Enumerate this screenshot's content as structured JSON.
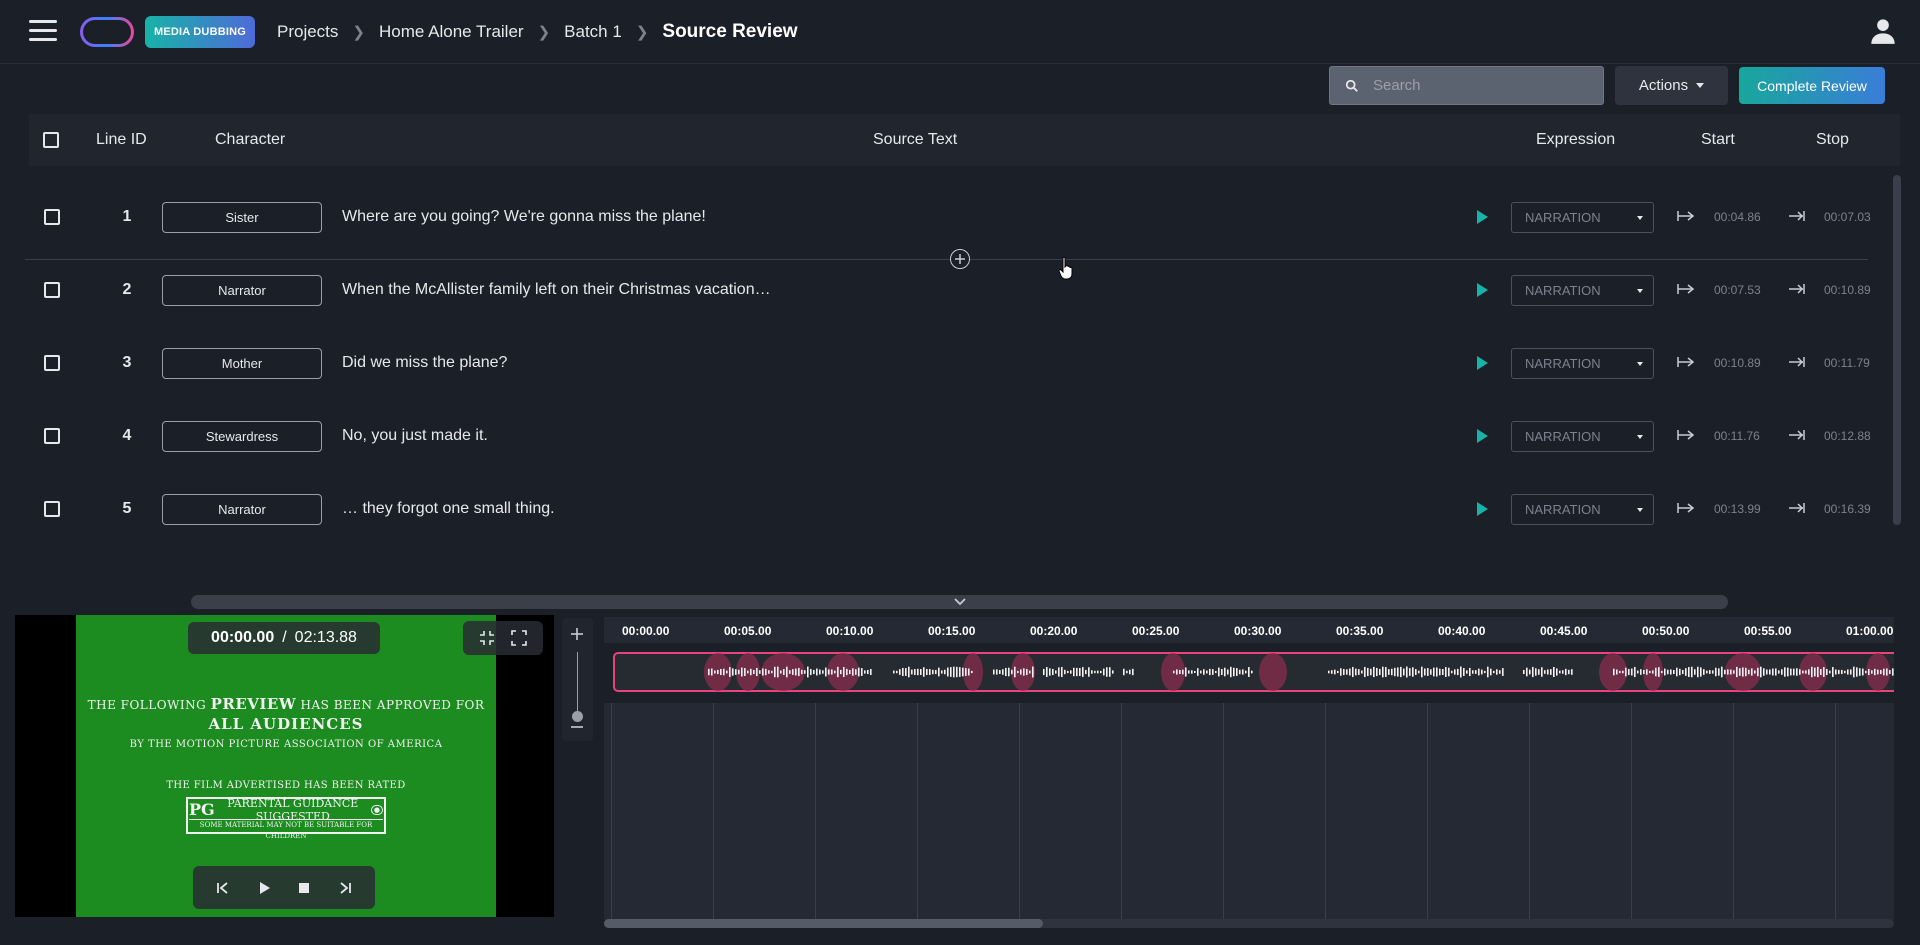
{
  "app": {
    "badge": "MEDIA DUBBING"
  },
  "breadcrumb": [
    "Projects",
    "Home Alone Trailer",
    "Batch 1",
    "Source Review"
  ],
  "toolbar": {
    "search_placeholder": "Search",
    "actions_label": "Actions",
    "complete_label": "Complete Review"
  },
  "table": {
    "headers": {
      "line_id": "Line ID",
      "character": "Character",
      "source_text": "Source Text",
      "expression": "Expression",
      "start": "Start",
      "stop": "Stop"
    },
    "rows": [
      {
        "id": "1",
        "character": "Sister",
        "text": "Where are you going? We're gonna miss the plane!",
        "expression": "NARRATION",
        "start": "00:04.86",
        "stop": "00:07.03"
      },
      {
        "id": "2",
        "character": "Narrator",
        "text": "When the McAllister family left on their Christmas vacation…",
        "expression": "NARRATION",
        "start": "00:07.53",
        "stop": "00:10.89"
      },
      {
        "id": "3",
        "character": "Mother",
        "text": "Did we miss the plane?",
        "expression": "NARRATION",
        "start": "00:10.89",
        "stop": "00:11.79"
      },
      {
        "id": "4",
        "character": "Stewardress",
        "text": "No, you just made it.",
        "expression": "NARRATION",
        "start": "00:11.76",
        "stop": "00:12.88"
      },
      {
        "id": "5",
        "character": "Narrator",
        "text": "… they forgot one small thing.",
        "expression": "NARRATION",
        "start": "00:13.99",
        "stop": "00:16.39"
      }
    ]
  },
  "player": {
    "current_time": "00:00.00",
    "separator": "/",
    "duration": "02:13.88",
    "frame_text": {
      "line1_pre": "THE FOLLOWING",
      "line1_bold": "PREVIEW",
      "line1_post": "HAS BEEN APPROVED FOR",
      "line2": "ALL AUDIENCES",
      "line3": "BY THE MOTION PICTURE ASSOCIATION OF AMERICA",
      "line4": "THE FILM ADVERTISED HAS BEEN RATED",
      "rating": "PG",
      "rating_text": "PARENTAL GUIDANCE SUGGESTED",
      "rating_sub": "SOME MATERIAL MAY NOT BE SUITABLE FOR CHILDREN"
    }
  },
  "timeline": {
    "ticks": [
      "00:00.00",
      "00:05.00",
      "00:10.00",
      "00:15.00",
      "00:20.00",
      "00:25.00",
      "00:30.00",
      "00:35.00",
      "00:40.00",
      "00:45.00",
      "00:50.00",
      "00:55.00",
      "01:00.00"
    ],
    "scroll_fraction": 0.34
  },
  "colors": {
    "accent": "#17b3a8",
    "clip_border": "#e8437a",
    "background": "#1b1f27"
  }
}
